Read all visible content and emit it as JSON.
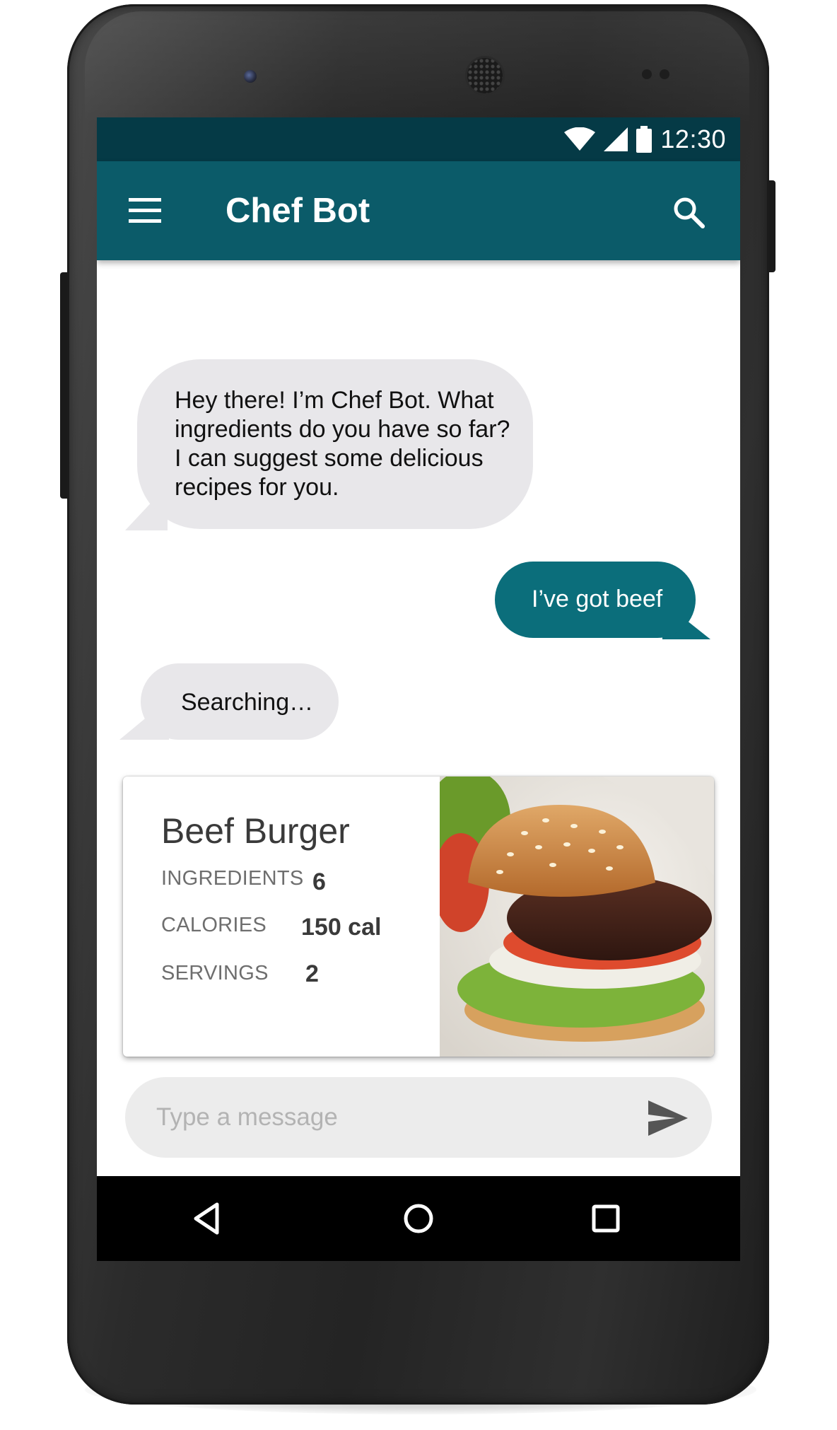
{
  "status_bar": {
    "time": "12:30",
    "icons": [
      "wifi-icon",
      "cell-signal-icon",
      "battery-icon"
    ]
  },
  "app_bar": {
    "title": "Chef Bot",
    "left_icon": "menu-icon",
    "right_icon": "search-icon",
    "color": "#0b5b69"
  },
  "messages": [
    {
      "sender": "bot",
      "text": "Hey there! I’m Chef Bot. What ingredients do you have so far? I can suggest some delicious recipes for you."
    },
    {
      "sender": "user",
      "text": "I’ve got beef"
    },
    {
      "sender": "bot",
      "text": "Searching…"
    }
  ],
  "recipe_card": {
    "title": "Beef Burger",
    "stats": [
      {
        "label": "INGREDIENTS",
        "value": "6"
      },
      {
        "label": "CALORIES",
        "value": "150 cal"
      },
      {
        "label": "SERVINGS",
        "value": "2"
      }
    ],
    "image": "beef-burger-photo"
  },
  "composer": {
    "placeholder": "Type a message",
    "value": "",
    "send_icon": "send-icon"
  },
  "nav_bar": {
    "icons": [
      "back-icon",
      "home-icon",
      "recents-icon"
    ]
  },
  "colors": {
    "status_bar": "#053a46",
    "accent": "#0b6e7b",
    "bot_bubble": "#e8e7ea"
  }
}
